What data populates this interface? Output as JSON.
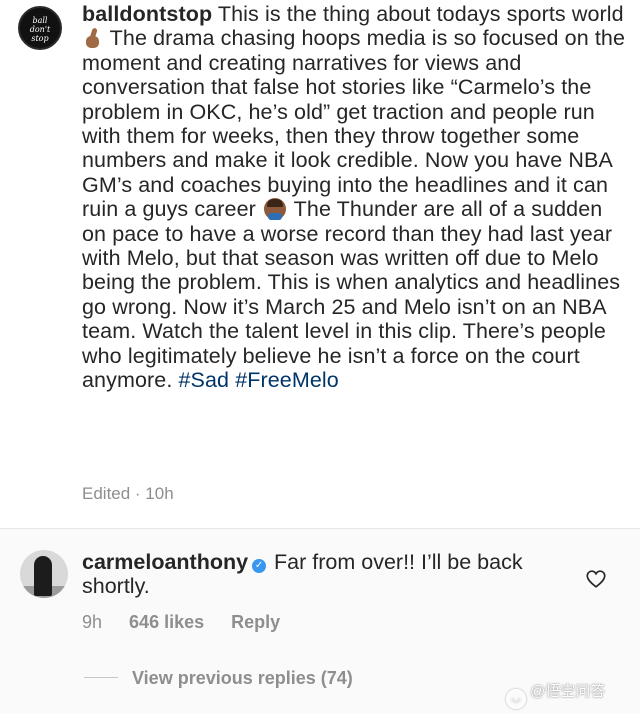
{
  "post_comment": {
    "avatar_text": [
      "ball",
      "don't",
      "stop"
    ],
    "username": "balldontstop",
    "text_part1": " This is the thing about todays sports world ",
    "emoji1": "point-up-hand-emoji",
    "text_part2": " The drama chasing hoops media is so focused on the moment and creating narratives for views and conversation that false hot stories like “Carmelo’s the problem in OKC, he’s old” get traction and people run with them for weeks, then they throw together some numbers and make it look credible. Now you have NBA GM’s and coaches buying into the headlines and it can ruin a guys career ",
    "emoji2": "facepalm-emoji",
    "text_part3": " The Thunder are all of a sudden on pace to have a worse record than they had last year with Melo, but that season was written off due to Melo being the problem. This is when analytics and headlines go wrong. Now it’s March 25 and Melo isn’t on an NBA team. Watch the talent level in this clip. There’s people who legitimately believe he isn’t a force on the court anymore. ",
    "hashtags": [
      "#Sad",
      "#FreeMelo"
    ],
    "edited_meta": "Edited · 10h"
  },
  "reply": {
    "username": "carmeloanthony",
    "verified_glyph": "✓",
    "text": " Far from over!! I’ll be back shortly.",
    "time": "9h",
    "likes": "646 likes",
    "reply_label": "Reply",
    "like_icon": "heart-outline-icon"
  },
  "view_previous_replies": "View previous replies (74)",
  "watermark": {
    "text": "@悟空问答",
    "icon_glyph": "◡"
  },
  "colors": {
    "text": "#262626",
    "meta": "#8e8e8e",
    "hashtag": "#003569",
    "verified": "#3897f0"
  }
}
